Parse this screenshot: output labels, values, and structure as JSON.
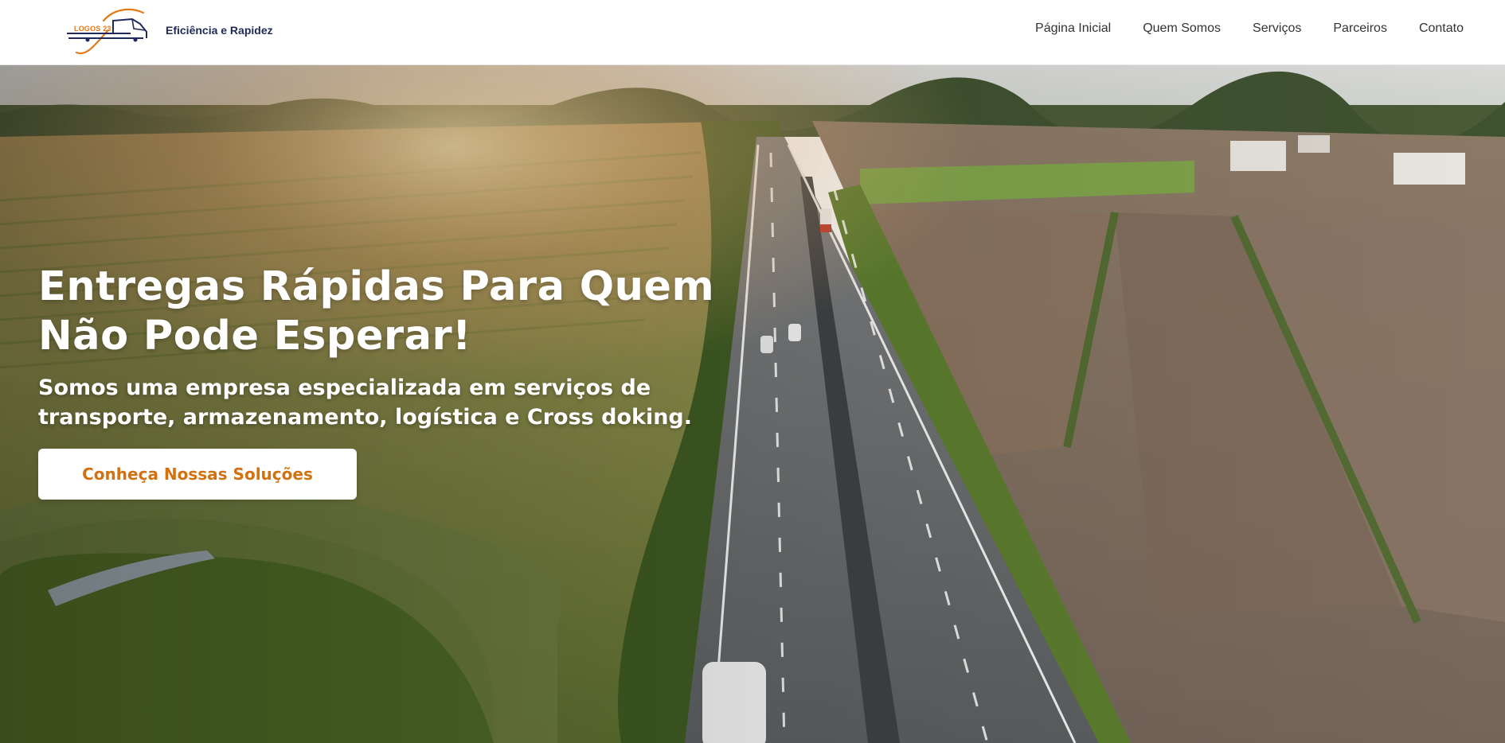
{
  "header": {
    "logo": {
      "text": "LOGOS 23",
      "icon": "truck-logo-icon"
    },
    "tagline": "Eficiência e Rapidez",
    "nav": [
      {
        "label": "Página Inicial"
      },
      {
        "label": "Quem Somos"
      },
      {
        "label": "Serviços"
      },
      {
        "label": "Parceiros"
      },
      {
        "label": "Contato"
      }
    ]
  },
  "hero": {
    "title_line1": "Entregas Rápidas Para Quem",
    "title_line2": "Não Pode Esperar!",
    "subtitle_line1": "Somos uma empresa especializada em serviços de",
    "subtitle_line2": "transporte, armazenamento, logística e Cross doking.",
    "cta_label": "Conheça Nossas Soluções",
    "background": "aerial-highway-farmland-photo"
  },
  "colors": {
    "accent": "#d4710f",
    "brand_navy": "#1f2a5a",
    "nav_text": "#333333"
  }
}
